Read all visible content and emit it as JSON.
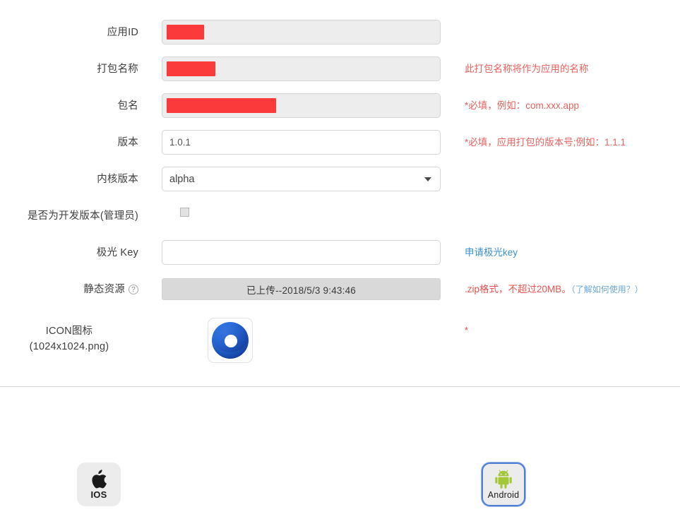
{
  "form": {
    "rows": [
      {
        "label": "应用ID",
        "field_kind": "redacted-input",
        "value": "",
        "placeholder": "",
        "redaction_width": "w-short",
        "readonly": true,
        "hint": "",
        "hint_style": ""
      },
      {
        "label": "打包名称",
        "field_kind": "redacted-input",
        "value": "",
        "placeholder": "",
        "redaction_width": "w-mid",
        "readonly": true,
        "hint": "此打包名称将作为应用的名称",
        "hint_style": "hint-red"
      },
      {
        "label": "包名",
        "field_kind": "redacted-input",
        "value": "",
        "placeholder": "",
        "redaction_width": "w-long",
        "readonly": true,
        "hint": "*必填，例如：com.xxx.app",
        "hint_style": "hint-red"
      },
      {
        "label": "版本",
        "field_kind": "input",
        "value": "1.0.1",
        "placeholder": "",
        "readonly": false,
        "hint": "*必填，应用打包的版本号;例如：1.1.1",
        "hint_style": "hint-red"
      },
      {
        "label": "内核版本",
        "field_kind": "select",
        "value": "alpha",
        "options": [
          "alpha"
        ],
        "hint": "",
        "hint_style": ""
      },
      {
        "label": "是否为开发版本(管理员)",
        "field_kind": "checkbox",
        "checked": false,
        "hint": "",
        "hint_style": ""
      },
      {
        "label": "极光 Key",
        "field_kind": "input",
        "value": "",
        "placeholder": "",
        "readonly": false,
        "hint": "申请极光key",
        "hint_style": "hint-blue"
      },
      {
        "label": "静态资源",
        "has_help": true,
        "help_glyph": "?",
        "field_kind": "upload",
        "value": "已上传--2018/5/3 9:43:46",
        "hint": ".zip格式，不超过20MB。",
        "hint_style": "hint-red2",
        "hint_extra": "（了解如何使用？）"
      },
      {
        "label_line1": "ICON图标",
        "label_line2": "(1024x1024.png)",
        "field_kind": "icon",
        "hint": "*",
        "hint_style": "req-star"
      }
    ]
  },
  "platforms": {
    "ios": {
      "label": "IOS",
      "icon": "apple-icon",
      "selected": false
    },
    "android": {
      "label": "Android",
      "icon": "android-robot-icon",
      "selected": true
    }
  },
  "colors": {
    "redaction": "#fb3b3b",
    "hint_red": "#e8625e",
    "hint_blue": "#3e8fd0",
    "selected_border": "#4f7fd4",
    "android_green": "#a4c639",
    "icon_blue": "#1f5fd0"
  }
}
